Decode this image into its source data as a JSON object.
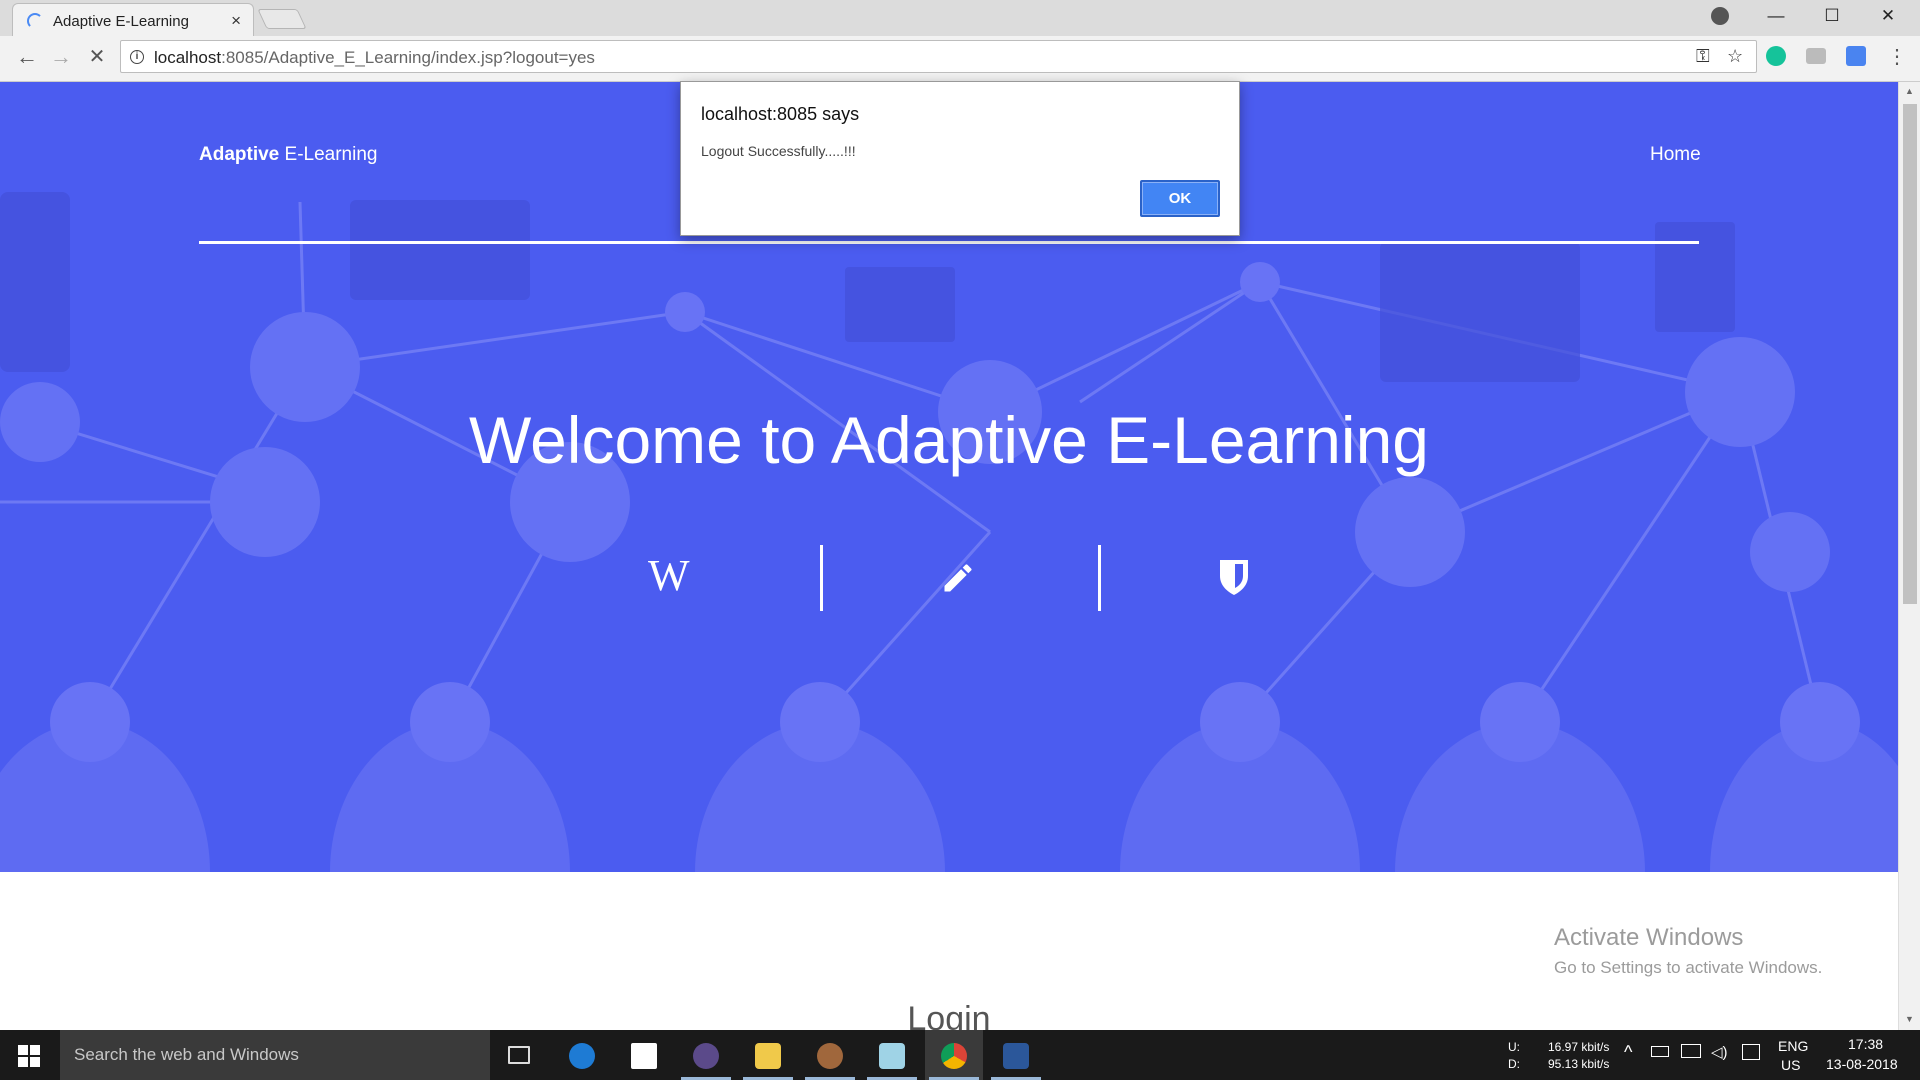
{
  "browser": {
    "tab_title": "Adaptive E-Learning",
    "tab_close": "×",
    "url_host": "localhost",
    "url_rest": ":8085/Adaptive_E_Learning/index.jsp?logout=yes",
    "window_controls": {
      "minimize": "—",
      "maximize": "☐",
      "close": "✕"
    },
    "nav": {
      "back": "←",
      "forward": "→",
      "reload": "✕"
    },
    "omni_icons": {
      "key": "⚿",
      "star": "☆",
      "menu": "⋮"
    }
  },
  "page": {
    "brand_bold": "Adaptive",
    "brand_rest": " E-Learning",
    "nav_home": "Home",
    "hero_title": "Welcome to Adaptive E-Learning",
    "hero_wiki_glyph": "W",
    "login_heading": "Login",
    "watermark_title": "Activate Windows",
    "watermark_sub": "Go to Settings to activate Windows."
  },
  "dialog": {
    "title": "localhost:8085 says",
    "message": "Logout Successfully.....!!!",
    "ok_label": "OK"
  },
  "taskbar": {
    "search_placeholder": "Search the web and Windows",
    "net_up_label": "U:",
    "net_down_label": "D:",
    "net_up": "16.97 kbit/s",
    "net_down": "95.13 kbit/s",
    "lang": "ENG",
    "region": "US",
    "time": "17:38",
    "date": "13-08-2018",
    "apps": [
      "task-view",
      "edge",
      "store",
      "eclipse",
      "file-explorer",
      "settings",
      "notepad",
      "chrome",
      "word"
    ]
  },
  "colors": {
    "hero_bg": "#4b5cf0",
    "dialog_ok": "#4285f4",
    "taskbar": "#1a1a1a"
  }
}
